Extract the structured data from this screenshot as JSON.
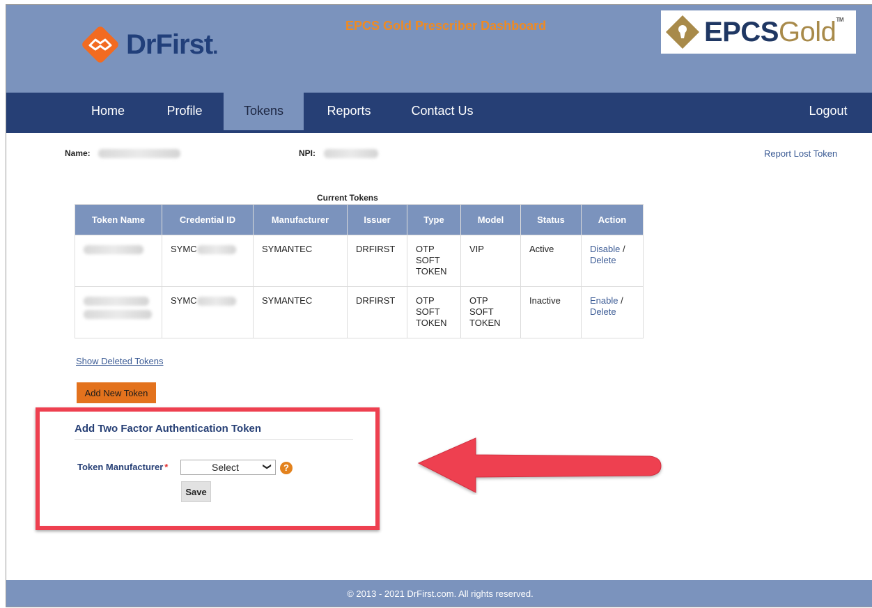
{
  "header": {
    "brand": "DrFirst",
    "brand_suffix": ".",
    "dashboard_title": "EPCS Gold Prescriber Dashboard",
    "epcs_logo_main": "EPCS",
    "epcs_logo_accent": "Gold",
    "epcs_logo_tm": "TM"
  },
  "nav": {
    "home": "Home",
    "profile": "Profile",
    "tokens": "Tokens",
    "reports": "Reports",
    "contact": "Contact Us",
    "logout": "Logout",
    "active": "Tokens"
  },
  "user_info": {
    "name_label": "Name:",
    "npi_label": "NPI:",
    "report_lost": "Report Lost Token"
  },
  "tokens_table": {
    "caption": "Current Tokens",
    "headers": [
      "Token Name",
      "Credential ID",
      "Manufacturer",
      "Issuer",
      "Type",
      "Model",
      "Status",
      "Action"
    ],
    "rows": [
      {
        "credential_prefix": "SYMC",
        "manufacturer": "SYMANTEC",
        "issuer": "DRFIRST",
        "type": [
          "OTP",
          "SOFT",
          "TOKEN"
        ],
        "model": [
          "VIP"
        ],
        "status": "Active",
        "action_primary": "Disable",
        "action_separator": " /",
        "action_secondary": "Delete"
      },
      {
        "credential_prefix": "SYMC",
        "manufacturer": "SYMANTEC",
        "issuer": "DRFIRST",
        "type": [
          "OTP",
          "SOFT",
          "TOKEN"
        ],
        "model": [
          "OTP",
          "SOFT",
          "TOKEN"
        ],
        "status": "Inactive",
        "action_primary": "Enable",
        "action_separator": " /",
        "action_secondary": "Delete"
      }
    ]
  },
  "links": {
    "show_deleted": "Show Deleted Tokens"
  },
  "buttons": {
    "add_new_token": "Add New Token",
    "save": "Save"
  },
  "add_token_form": {
    "title": "Add Two Factor Authentication Token",
    "manufacturer_label": "Token Manufacturer",
    "required_marker": "*",
    "select_value": "Select",
    "help_glyph": "?"
  },
  "colors": {
    "header_bg": "#7b93bd",
    "nav_bg": "#263f75",
    "accent_orange": "#e3721d",
    "highlight_red": "#ee4050",
    "link_blue": "#3a5a94"
  },
  "footer": {
    "copyright": "© 2013 - 2021 DrFirst.com. All rights reserved."
  }
}
